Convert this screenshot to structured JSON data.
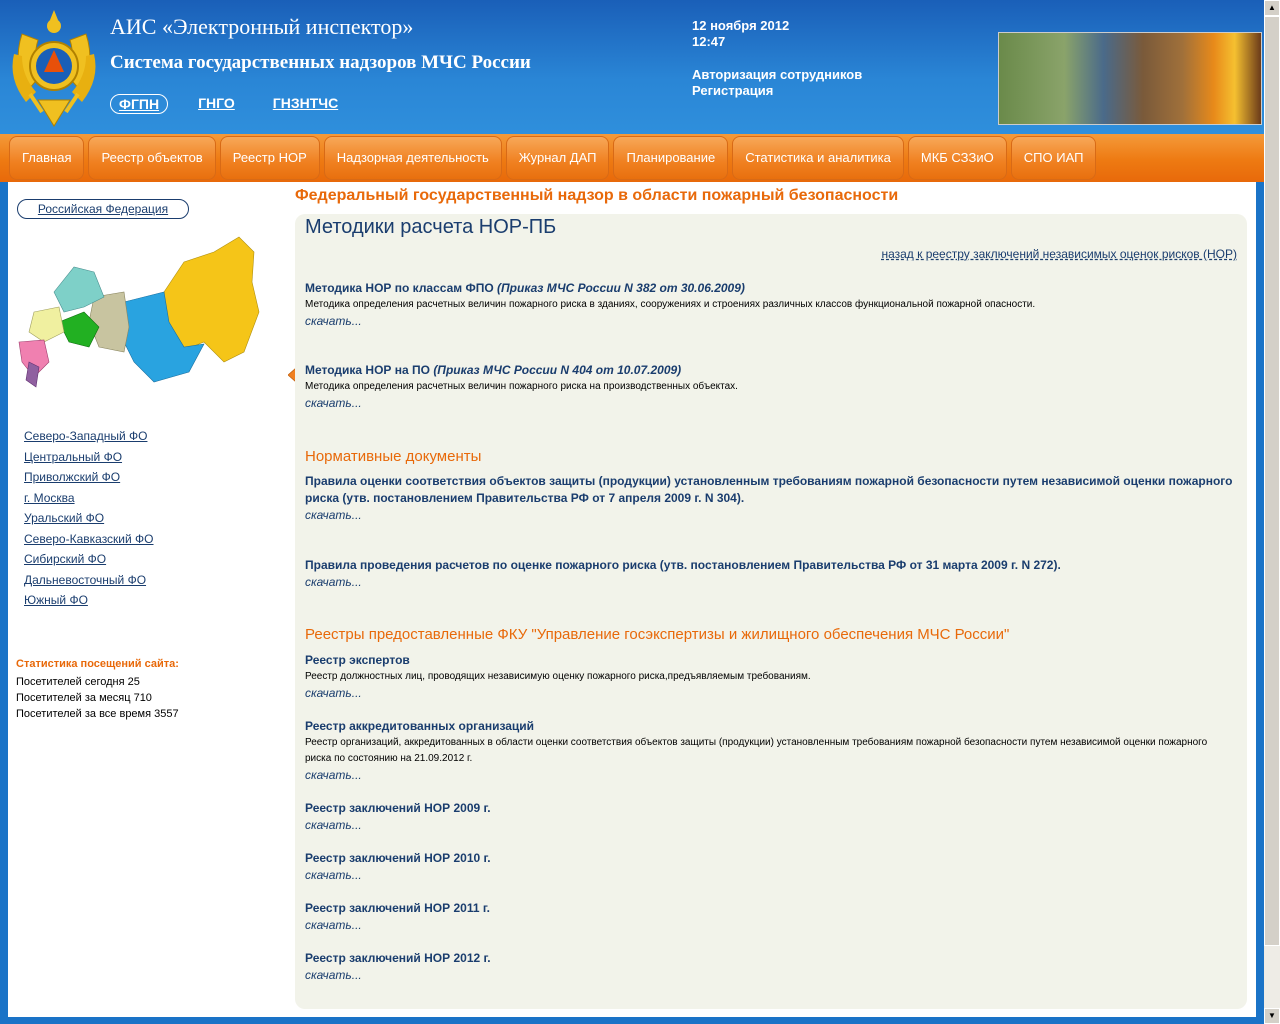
{
  "header": {
    "title1": "АИС «Электронный инспектор»",
    "title2": "Система государственных надзоров МЧС России",
    "links": [
      "ФГПН",
      "ГНГО",
      "ГНЗНТЧС"
    ],
    "date": "12 ноября 2012",
    "time": "12:47",
    "auth_link": "Авторизация сотрудников",
    "register_link": "Регистрация"
  },
  "nav": {
    "tabs": [
      "Главная",
      "Реестр объектов",
      "Реестр НОР",
      "Надзорная деятельность",
      "Журнал ДАП",
      "Планирование",
      "Статистика и аналитика",
      "МКБ СЗЗиО",
      "СПО ИАП"
    ]
  },
  "sidebar": {
    "rf_button": "Российская Федерация",
    "districts": [
      "Северо-Западный ФО",
      "Центральный ФО",
      "Приволжский ФО",
      "г. Москва",
      "Уральский ФО",
      "Северо-Кавказский ФО",
      "Сибирский ФО",
      "Дальневосточный ФО",
      "Южный ФО"
    ],
    "stats_title": "Статистика посещений сайта:",
    "stats": [
      "Посетителей сегодня 25",
      "Посетителей за месяц 710",
      "Посетителей за все время 3557"
    ]
  },
  "main": {
    "fed_title": "Федеральный государственный надзор в области пожарный безопасности",
    "title": "Методики расчета НОР-ПБ",
    "back_link": "назад к реестру заключений независимых оценок рисков (НОР)",
    "download": "скачать...",
    "m1_title": "Методика НОР по классам ФПО",
    "m1_order": "(Приказ МЧС России N 382 от 30.06.2009)",
    "m1_desc": "Методика определения расчетных величин пожарного риска в зданиях, сооружениях и строениях различных классов функциональной пожарной опасности.",
    "m2_title": "Методика НОР на ПО",
    "m2_order": "(Приказ МЧС России N 404 от 10.07.2009)",
    "m2_desc": "Методика определения расчетных величин пожарного риска на производственных объектах.",
    "sect_norm": "Нормативные документы",
    "n1_title": "Правила оценки соответствия объектов защиты (продукции) установленным требованиям пожарной безопасности путем независимой оценки пожарного риска (утв. постановлением Правительства РФ от 7 апреля 2009 г. N 304).",
    "n2_title": "Правила проведения расчетов по оценке пожарного риска (утв. постановлением Правительства РФ от 31 марта 2009 г. N 272).",
    "sect_reg": "Реестры предоставленные ФКУ \"Управление госэкспертизы и жилищного обеспечения МЧС России\"",
    "r1_title": "Реестр экспертов",
    "r1_desc": "Реестр должностных лиц, проводящих независимую оценку пожарного риска,предъявляемым требованиям.",
    "r2_title": "Реестр аккредитованных организаций",
    "r2_desc": "Реестр организаций, аккредитованных в области оценки соответствия объектов защиты (продукции) установленным требованиям пожарной безопасности путем независимой оценки пожарного риска по состоянию на 21.09.2012 г.",
    "r3_title": "Реестр заключений НОР 2009 г.",
    "r4_title": "Реестр заключений НОР 2010 г.",
    "r5_title": "Реестр заключений НОР 2011 г.",
    "r6_title": "Реестр заключений НОР 2012 г."
  }
}
